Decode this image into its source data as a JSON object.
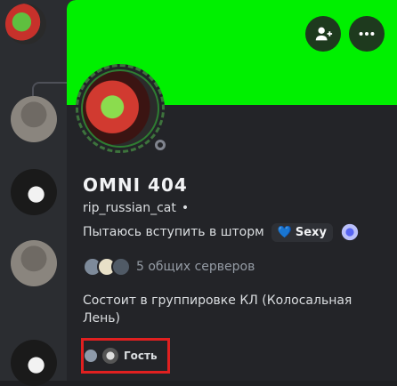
{
  "profile": {
    "display_name": "OMNI 404",
    "username": "rip_russian_cat",
    "custom_status": "Пытаюсь вступить в шторм",
    "tag": {
      "heart": "💙",
      "label": "Sexy"
    },
    "mutual_servers": "5 общих серверов",
    "bio": "Состоит в группировке КЛ (Колосальная Лень)",
    "banner_color": "#00f000",
    "presence": "offline"
  },
  "roles": [
    {
      "label": "Гость"
    }
  ],
  "icons": {
    "add_friend": "add-friend-icon",
    "more": "more-icon"
  }
}
